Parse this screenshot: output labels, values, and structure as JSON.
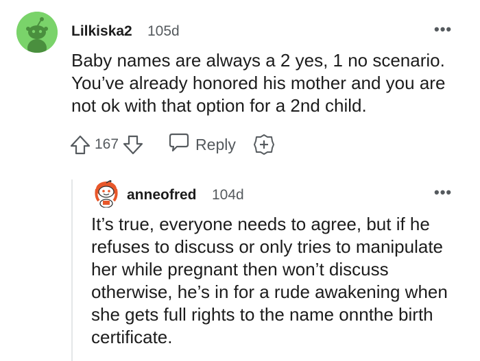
{
  "top_comment": {
    "author": "Lilkiska2",
    "time": "105d",
    "more": "•••",
    "body": "Baby names are always a 2 yes, 1 no scenario. You’ve already honored his mother and you are not ok with that option for a 2nd child.",
    "votes": "167",
    "reply_label": "Reply",
    "avatar_color": "#7ad36a"
  },
  "reply_comment": {
    "author": "anneofred",
    "time": "104d",
    "more": "•••",
    "body": "It’s true, everyone needs to agree, but if he refuses to discuss or only tries to manipulate her while pregnant then won’t discuss otherwise, he’s in for a rude awakening when she gets full rights to the name onnthe birth certificate."
  },
  "colors": {
    "text": "#1c1c1c",
    "meta": "#555a5e",
    "thread_line": "#e4e6e8"
  }
}
